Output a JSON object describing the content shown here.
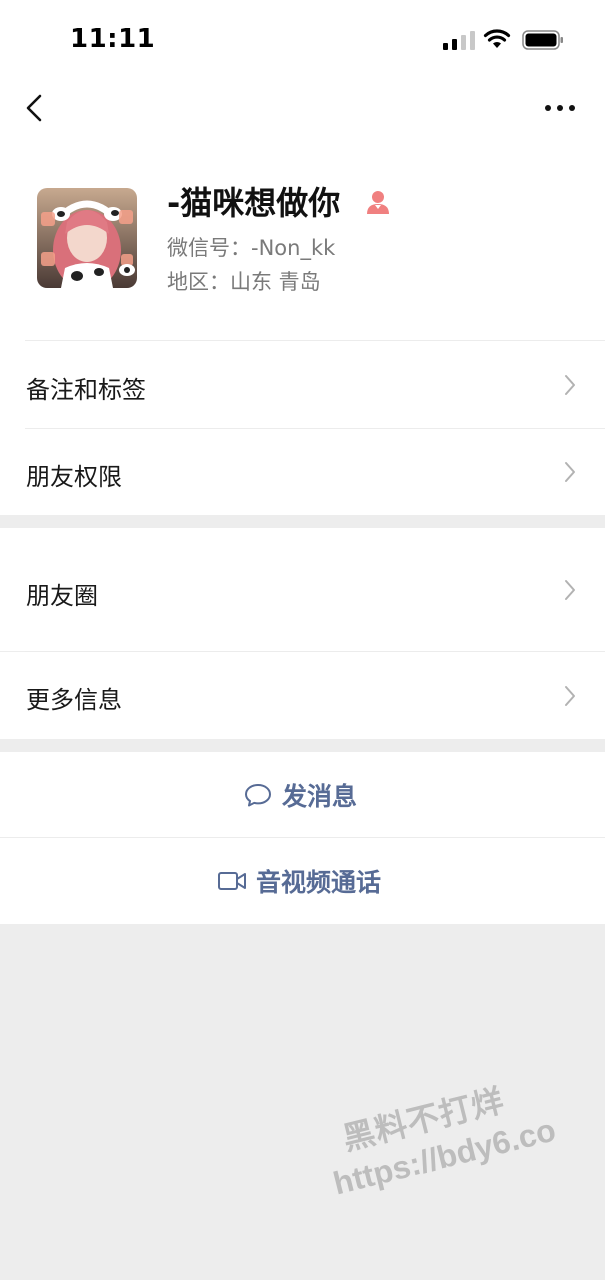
{
  "status_bar": {
    "time": "11:11"
  },
  "nav": {
    "back_icon": "chevron-left-icon",
    "more_icon": "ellipsis-icon"
  },
  "profile": {
    "name": "-猫咪想做你",
    "gender_icon": "female-icon",
    "wechat_id": "微信号：-Non_kk",
    "region": "地区：山东 青岛"
  },
  "rows": {
    "notes_tags": "备注和标签",
    "friend_permissions": "朋友权限",
    "moments": "朋友圈",
    "more_info": "更多信息"
  },
  "actions": {
    "send_message": "发消息",
    "av_call": "音视频通话"
  },
  "watermark": {
    "line1": "黑料不打烊",
    "line2": "https://bdy6.co"
  },
  "colors": {
    "link_blue": "#576b95",
    "female_icon": "#f08080",
    "background_gray": "#ededed"
  }
}
